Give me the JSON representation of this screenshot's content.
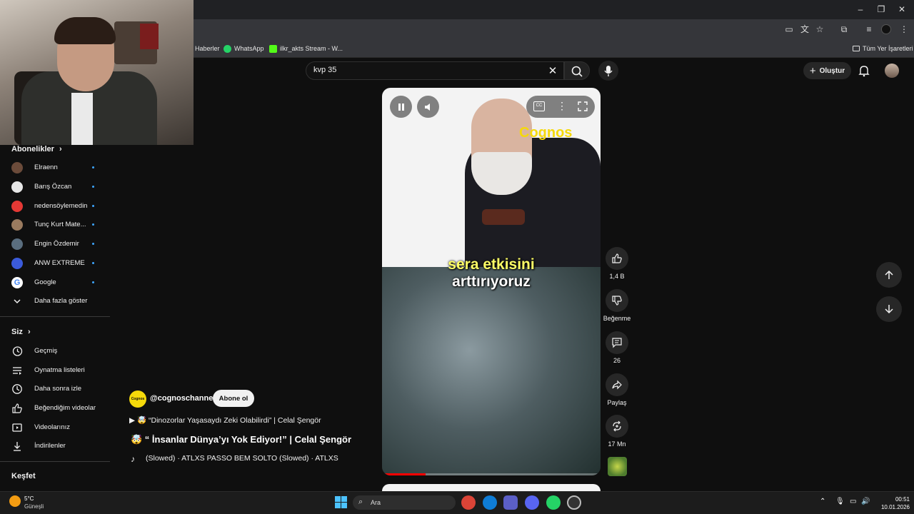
{
  "browser": {
    "bookmarks": [
      {
        "label": "Haberler",
        "icon": "news-icon",
        "color": "#8ab4f8"
      },
      {
        "label": "WhatsApp",
        "icon": "whatsapp-icon",
        "color": "#25d366"
      },
      {
        "label": "ilkr_akts Stream - W...",
        "icon": "kick-icon",
        "color": "#53fc18"
      }
    ],
    "all_bookmarks": "Tüm Yer İşaretleri"
  },
  "youtube": {
    "search": {
      "value": "kvp 35"
    },
    "create_label": "Oluştur"
  },
  "sidebar": {
    "subscriptions_title": "Abonelikler",
    "subscriptions": [
      {
        "label": "Elraenn",
        "color": "#6b4b3a"
      },
      {
        "label": "Barış Özcan",
        "color": "#e6e6e6"
      },
      {
        "label": "nedensöylemedin",
        "color": "#e53935"
      },
      {
        "label": "Tunç Kurt Mate...",
        "color": "#9a7b5f"
      },
      {
        "label": "Engin Özdemir",
        "color": "#5a6e7f"
      },
      {
        "label": "ANW EXTREME",
        "color": "#3b5bdb"
      },
      {
        "label": "Google",
        "color": "#ffffff"
      }
    ],
    "show_more": "Daha fazla göster",
    "you_title": "Siz",
    "you_items": [
      {
        "label": "Geçmiş",
        "icon": "history-icon"
      },
      {
        "label": "Oynatma listeleri",
        "icon": "playlists-icon"
      },
      {
        "label": "Daha sonra izle",
        "icon": "watch-later-icon"
      },
      {
        "label": "Beğendiğim videolar",
        "icon": "liked-icon"
      },
      {
        "label": "Videolarınız",
        "icon": "your-videos-icon"
      },
      {
        "label": "İndirilenler",
        "icon": "downloads-icon"
      }
    ],
    "explore_title": "Keşfet"
  },
  "video": {
    "watermark": "Cognos",
    "caption_line1": "sera etkisini",
    "caption_line2": "arttırıyoruz",
    "progress": 0.2
  },
  "actions": {
    "like_count": "1,4 B",
    "dislike_label": "Beğenme",
    "comment_count": "26",
    "share_label": "Paylaş",
    "remix_count": "17 Mn"
  },
  "channel": {
    "logo_text": "Cognos",
    "handle": "@cognoschannel",
    "subscribe_label": "Abone ol",
    "playlist_line": "▶ 🤯 “Dinozorlar Yaşasaydı Zeki Olabilirdi”  | Celal Şengör",
    "title": "🤯 “ İnsanlar Dünya’yı Yok Ediyor!” | Celal Şengör",
    "music_line": "(Slowed) · ATLXS    PASSO BEM SOLTO (Slowed) · ATLXS"
  },
  "taskbar": {
    "weather_temp": "5°C",
    "weather_desc": "Güneşli",
    "search_placeholder": "Ara",
    "time": "00:51",
    "date": "10.01.2026"
  }
}
